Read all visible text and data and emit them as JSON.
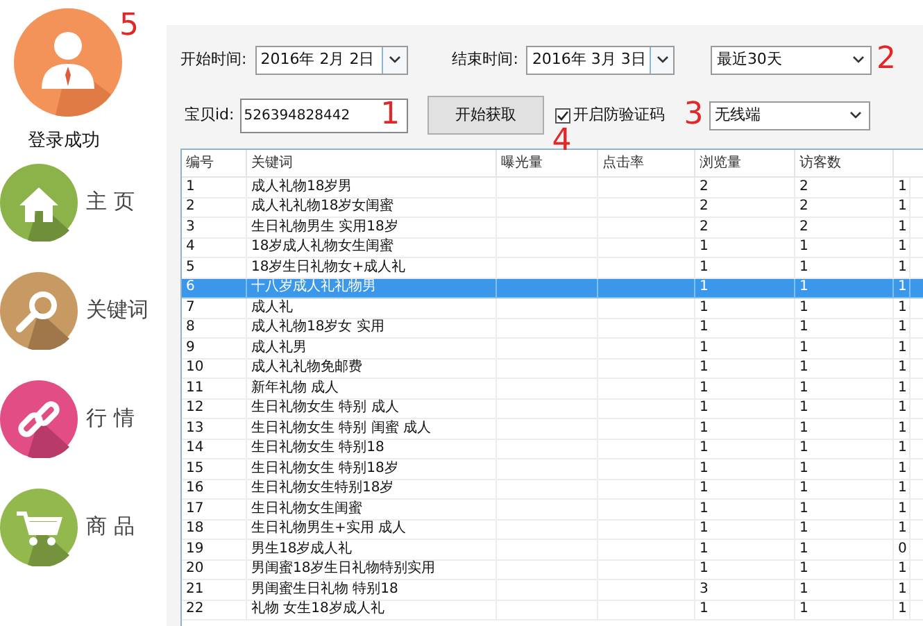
{
  "sidebar": {
    "login_status": "登录成功",
    "badge": "5",
    "items": [
      {
        "label": "主 页",
        "kind": "home"
      },
      {
        "label": "关键词",
        "kind": "search"
      },
      {
        "label": "行 情",
        "kind": "link"
      },
      {
        "label": "商 品",
        "kind": "cart"
      }
    ]
  },
  "controls": {
    "start_label": "开始时间:",
    "start_date": "2016年 2月 2日",
    "end_label": "结束时间:",
    "end_date": "2016年 3月 3日",
    "range": "最近30天",
    "range_marker": "2",
    "id_label": "宝贝id:",
    "id_value": "526394828442",
    "id_marker": "1",
    "fetch_button": "开始获取",
    "captcha": {
      "label": "开启防验证码",
      "checked": true
    },
    "captcha_marker": "4",
    "platform": "无线端",
    "platform_marker": "3"
  },
  "table": {
    "columns": [
      "编号",
      "关键词",
      "曝光量",
      "点击率",
      "浏览量",
      "访客数"
    ],
    "rows": [
      {
        "cells": [
          "1",
          "成人礼物18岁男",
          null,
          null,
          "2",
          "2",
          "1"
        ],
        "selected": false
      },
      {
        "cells": [
          "2",
          "成人礼礼物18岁女闺蜜",
          null,
          null,
          "2",
          "2",
          "1"
        ],
        "selected": false
      },
      {
        "cells": [
          "3",
          "生日礼物男生 实用18岁",
          null,
          null,
          "2",
          "2",
          "1"
        ],
        "selected": false
      },
      {
        "cells": [
          "4",
          "18岁成人礼物女生闺蜜",
          null,
          null,
          "1",
          "1",
          "1"
        ],
        "selected": false
      },
      {
        "cells": [
          "5",
          "18岁生日礼物女+成人礼",
          null,
          null,
          "1",
          "1",
          "1"
        ],
        "selected": false
      },
      {
        "cells": [
          "6",
          "十八岁成人礼礼物男",
          null,
          null,
          "1",
          "1",
          "1"
        ],
        "selected": true
      },
      {
        "cells": [
          "7",
          "成人礼",
          null,
          null,
          "1",
          "1",
          "1"
        ],
        "selected": false
      },
      {
        "cells": [
          "8",
          "成人礼物18岁女 实用",
          null,
          null,
          "1",
          "1",
          "1"
        ],
        "selected": false
      },
      {
        "cells": [
          "9",
          "成人礼男",
          null,
          null,
          "1",
          "1",
          "1"
        ],
        "selected": false
      },
      {
        "cells": [
          "10",
          "成人礼礼物免邮费",
          null,
          null,
          "1",
          "1",
          "1"
        ],
        "selected": false
      },
      {
        "cells": [
          "11",
          "新年礼物 成人",
          null,
          null,
          "1",
          "1",
          "1"
        ],
        "selected": false
      },
      {
        "cells": [
          "12",
          "生日礼物女生 特别 成人",
          null,
          null,
          "1",
          "1",
          "1"
        ],
        "selected": false
      },
      {
        "cells": [
          "13",
          "生日礼物女生 特别 闺蜜 成人",
          null,
          null,
          "1",
          "1",
          "1"
        ],
        "selected": false
      },
      {
        "cells": [
          "14",
          "生日礼物女生 特别18",
          null,
          null,
          "1",
          "1",
          "1"
        ],
        "selected": false
      },
      {
        "cells": [
          "15",
          "生日礼物女生 特别18岁",
          null,
          null,
          "1",
          "1",
          "1"
        ],
        "selected": false
      },
      {
        "cells": [
          "16",
          "生日礼物女生特别18岁",
          null,
          null,
          "1",
          "1",
          "1"
        ],
        "selected": false
      },
      {
        "cells": [
          "17",
          "生日礼物女生闺蜜",
          null,
          null,
          "1",
          "1",
          "1"
        ],
        "selected": false
      },
      {
        "cells": [
          "18",
          "生日礼物男生+实用 成人",
          null,
          null,
          "1",
          "1",
          "1"
        ],
        "selected": false
      },
      {
        "cells": [
          "19",
          "男生18岁成人礼",
          null,
          null,
          "1",
          "1",
          "0"
        ],
        "selected": false
      },
      {
        "cells": [
          "20",
          "男闺蜜18岁生日礼物特别实用",
          null,
          null,
          "1",
          "1",
          "1"
        ],
        "selected": false
      },
      {
        "cells": [
          "21",
          "男闺蜜生日礼物 特别18",
          null,
          null,
          "3",
          "1",
          "1"
        ],
        "selected": false
      },
      {
        "cells": [
          "22",
          "礼物 女生18岁成人礼",
          null,
          null,
          "1",
          "1",
          "1"
        ],
        "selected": false
      }
    ]
  }
}
